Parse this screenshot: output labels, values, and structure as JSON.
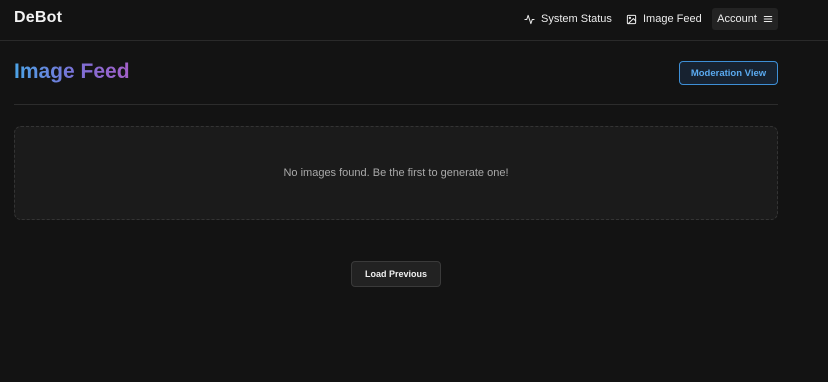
{
  "header": {
    "brand": "DeBot",
    "nav": [
      {
        "label": "System Status",
        "icon": "activity-icon"
      },
      {
        "label": "Image Feed",
        "icon": "image-icon"
      }
    ],
    "account": {
      "label": "Account",
      "icon": "menu-icon"
    }
  },
  "page": {
    "title": "Image Feed",
    "moderation_button": "Moderation View",
    "empty_message": "No images found. Be the first to generate one!",
    "load_previous_button": "Load Previous"
  },
  "colors": {
    "background": "#131313",
    "panel": "#1b1b1b",
    "accent": "#3e8fd6",
    "title_gradient_start": "#4ba3e6",
    "title_gradient_end": "#a35fc7"
  }
}
